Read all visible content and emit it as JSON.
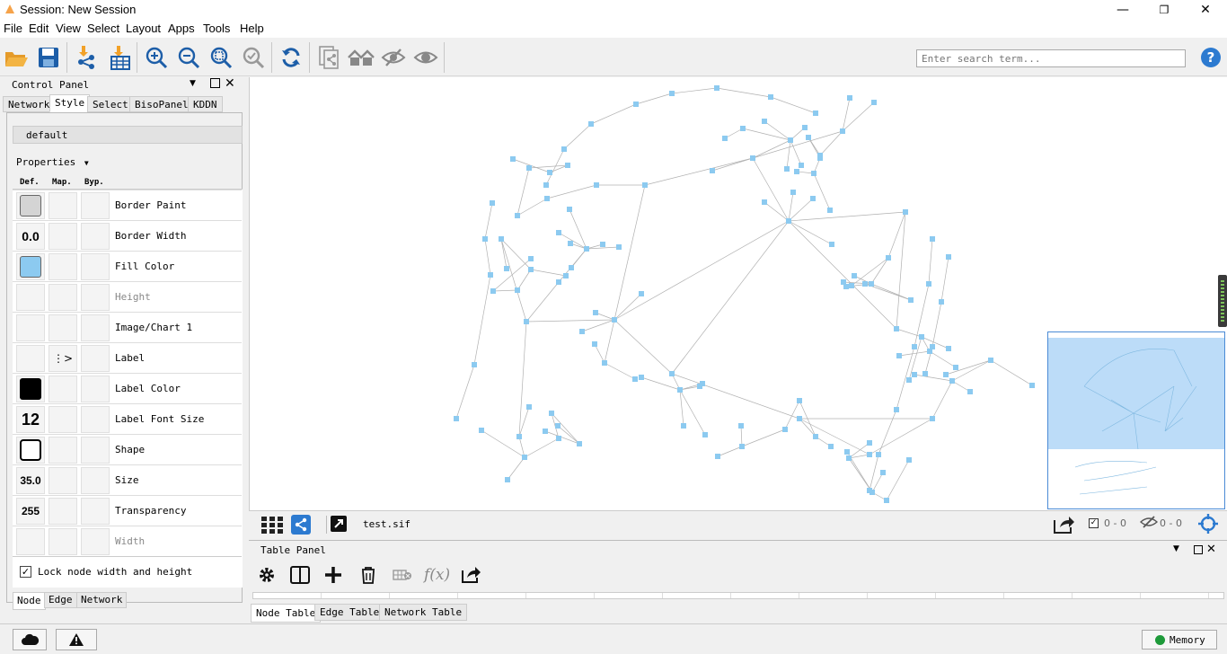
{
  "window": {
    "title": "Session: New Session"
  },
  "menu": [
    "File",
    "Edit",
    "View",
    "Select",
    "Layout",
    "Apps",
    "Tools",
    "Help"
  ],
  "toolbar": {
    "search_placeholder": "Enter search term..."
  },
  "control_panel": {
    "title": "Control Panel",
    "tabs": [
      "Network",
      "Style",
      "Select",
      "BisoPanel",
      "KDDN"
    ],
    "style_name": "default",
    "properties_label": "Properties",
    "columns": [
      "Def.",
      "Map.",
      "Byp."
    ],
    "properties": [
      {
        "name": "Border Paint",
        "def": ""
      },
      {
        "name": "Border Width",
        "def": "0.0"
      },
      {
        "name": "Fill Color",
        "def": ""
      },
      {
        "name": "Height",
        "def": ""
      },
      {
        "name": "Image/Chart 1",
        "def": ""
      },
      {
        "name": "Label",
        "def": ""
      },
      {
        "name": "Label Color",
        "def": ""
      },
      {
        "name": "Label Font Size",
        "def": "12"
      },
      {
        "name": "Shape",
        "def": ""
      },
      {
        "name": "Size",
        "def": "35.0"
      },
      {
        "name": "Transparency",
        "def": "255"
      },
      {
        "name": "Width",
        "def": ""
      }
    ],
    "lock_label": "Lock node width and height",
    "bottom_tabs": [
      "Node",
      "Edge",
      "Network"
    ]
  },
  "network_view": {
    "network_name": "test.sif",
    "node_count": "0 - 0",
    "edge_count": "0 - 0"
  },
  "table_panel": {
    "title": "Table Panel",
    "tabs": [
      "Node Table",
      "Edge Table",
      "Network Table"
    ]
  },
  "status": {
    "memory_label": "Memory"
  },
  "colors": {
    "node": "#8ccaf0",
    "edge": "#b0b0b0",
    "overview_fill": "#bcdcf8",
    "fill_swatch": "#8ccaf0"
  }
}
